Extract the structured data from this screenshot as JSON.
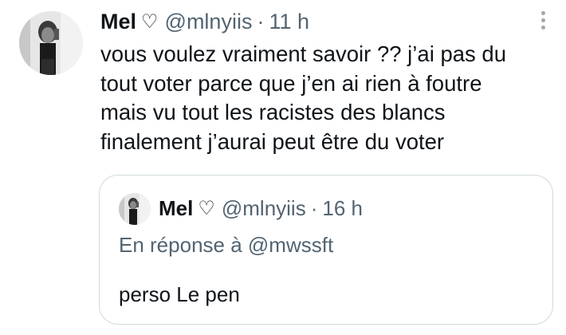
{
  "tweet": {
    "author_name": "Mel",
    "author_emoji": "♡",
    "handle": "@mlnyiis",
    "separator": "·",
    "time": "11 h",
    "text_lines": [
      "vous voulez vraiment savoir ?? j’ai pas du",
      "tout voter parce que j’en ai rien à foutre",
      "mais vu tout les racistes des blancs",
      "finalement j’aurai peut être du voter"
    ]
  },
  "quoted": {
    "author_name": "Mel",
    "author_emoji": "♡",
    "handle": "@mlnyiis",
    "separator": "·",
    "time": "16 h",
    "reply_to": "En réponse à @mwssft",
    "text": "perso Le pen"
  },
  "icons": {
    "more": "more-vertical-icon",
    "heart": "heart-outline-icon"
  },
  "colors": {
    "primary_text": "#0f1419",
    "secondary_text": "#536471",
    "border": "#cfd9de",
    "background": "#ffffff"
  }
}
